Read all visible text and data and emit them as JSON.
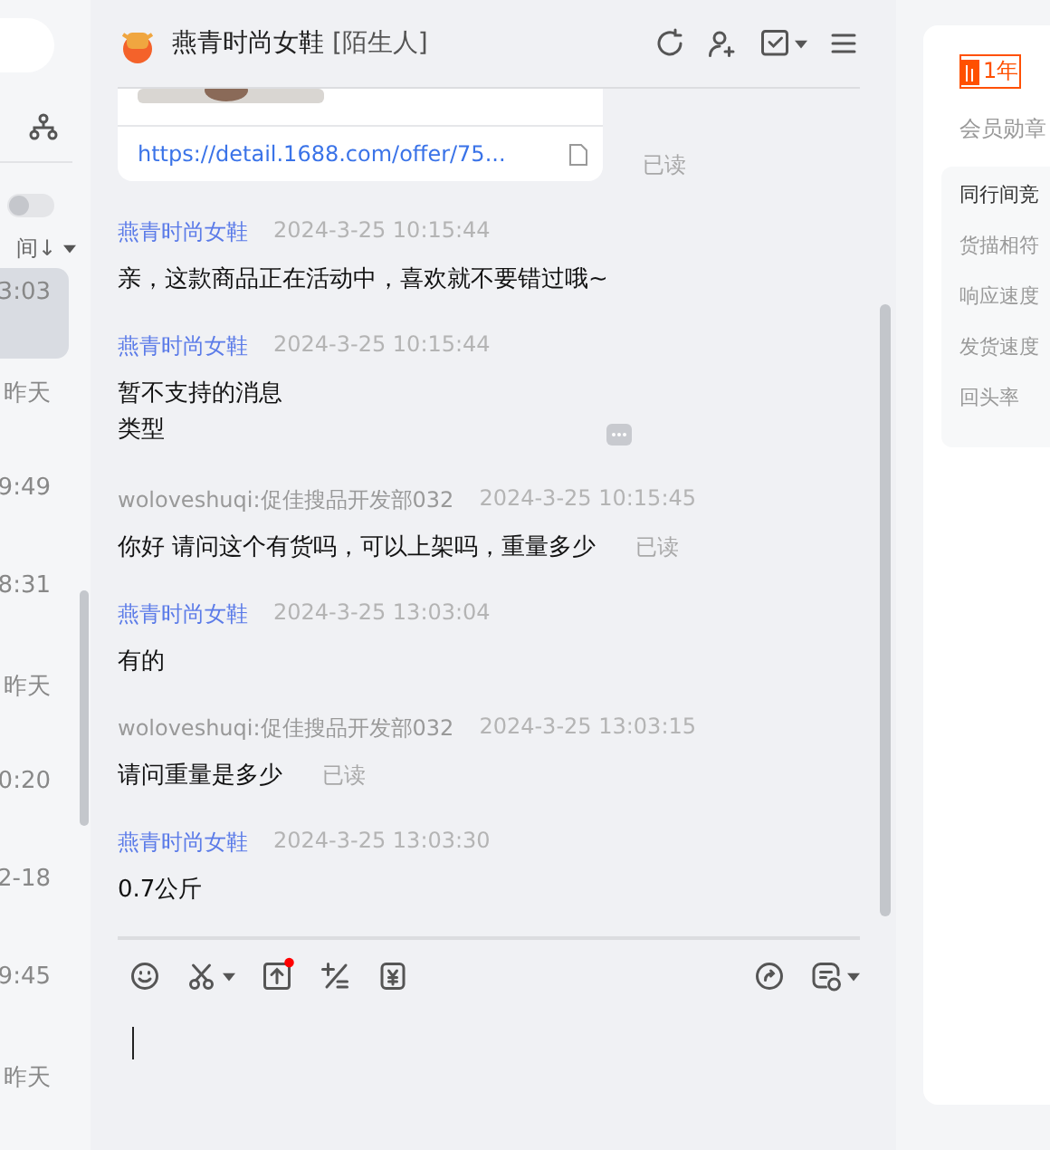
{
  "sidebar": {
    "sort_label": "间↓",
    "toggle": {
      "on": false
    },
    "items": [
      {
        "time": "3:03",
        "selected": true
      },
      {
        "time": "昨天",
        "selected": false
      },
      {
        "time": "9:49",
        "selected": false
      },
      {
        "time": "8:31",
        "selected": false
      },
      {
        "time": "昨天",
        "selected": false
      },
      {
        "time": "0:20",
        "selected": false
      },
      {
        "time": "2-18",
        "selected": false
      },
      {
        "time": "9:45",
        "selected": false
      },
      {
        "time": "昨天",
        "selected": false
      }
    ]
  },
  "chat": {
    "title": "燕青时尚女鞋",
    "tag": "[陌生人]",
    "product_card": {
      "link": "https://detail.1688.com/offer/75...",
      "status": "已读"
    },
    "messages": [
      {
        "sender": "燕青时尚女鞋",
        "mine": false,
        "time": "2024-3-25 10:15:44",
        "text": "亲，这款商品正在活动中，喜欢就不要错过哦~"
      },
      {
        "sender": "燕青时尚女鞋",
        "mine": false,
        "time": "2024-3-25 10:15:44",
        "text": "暂不支持的消息类型",
        "kind": "unsupported"
      },
      {
        "sender": "woloveshuqi:促佳搜品开发部032",
        "mine": true,
        "time": "2024-3-25 10:15:45",
        "text": "你好 请问这个有货吗，可以上架吗，重量多少",
        "status": "已读"
      },
      {
        "sender": "燕青时尚女鞋",
        "mine": false,
        "time": "2024-3-25 13:03:04",
        "text": "有的"
      },
      {
        "sender": "woloveshuqi:促佳搜品开发部032",
        "mine": true,
        "time": "2024-3-25 13:03:15",
        "text": "请问重量是多少",
        "status": "已读"
      },
      {
        "sender": "燕青时尚女鞋",
        "mine": false,
        "time": "2024-3-25 13:03:30",
        "text": "0.7公斤"
      }
    ]
  },
  "profile": {
    "badge": "1年",
    "medal_label": "会员勋章",
    "stats_title": "同行间竞",
    "stats": [
      "货描相符",
      "响应速度",
      "发货速度",
      "回头率"
    ]
  }
}
